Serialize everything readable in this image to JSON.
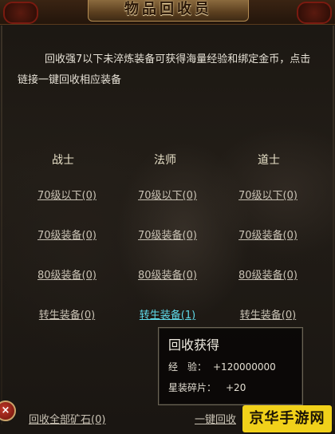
{
  "header": {
    "title": "物品回收员"
  },
  "description": "回收强7以下未淬炼装备可获得海量经验和绑定金币，点击链接一键回收相应装备",
  "columns": [
    {
      "name": "战士",
      "links": [
        "70级以下(0)",
        "70级装备(0)",
        "80级装备(0)",
        "转生装备(0)"
      ]
    },
    {
      "name": "法师",
      "links": [
        "70级以下(0)",
        "70级装备(0)",
        "80级装备(0)",
        "转生装备(1)"
      ]
    },
    {
      "name": "道士",
      "links": [
        "70级以下(0)",
        "70级装备(0)",
        "80级装备(0)",
        "转生装备(0)"
      ]
    }
  ],
  "tooltip": {
    "title": "回收获得",
    "rows": [
      {
        "label": "经　验：",
        "value": "+120000000"
      },
      {
        "label": "星装碎片：",
        "value": "+20"
      }
    ]
  },
  "footer": {
    "recycle_ore": "回收全部矿石(0)",
    "recycle_one_key": "一键回收"
  },
  "watermark": "京华手游网",
  "colors": {
    "active_link": "#5fd9e8",
    "watermark_bg": "#f1d11a"
  }
}
